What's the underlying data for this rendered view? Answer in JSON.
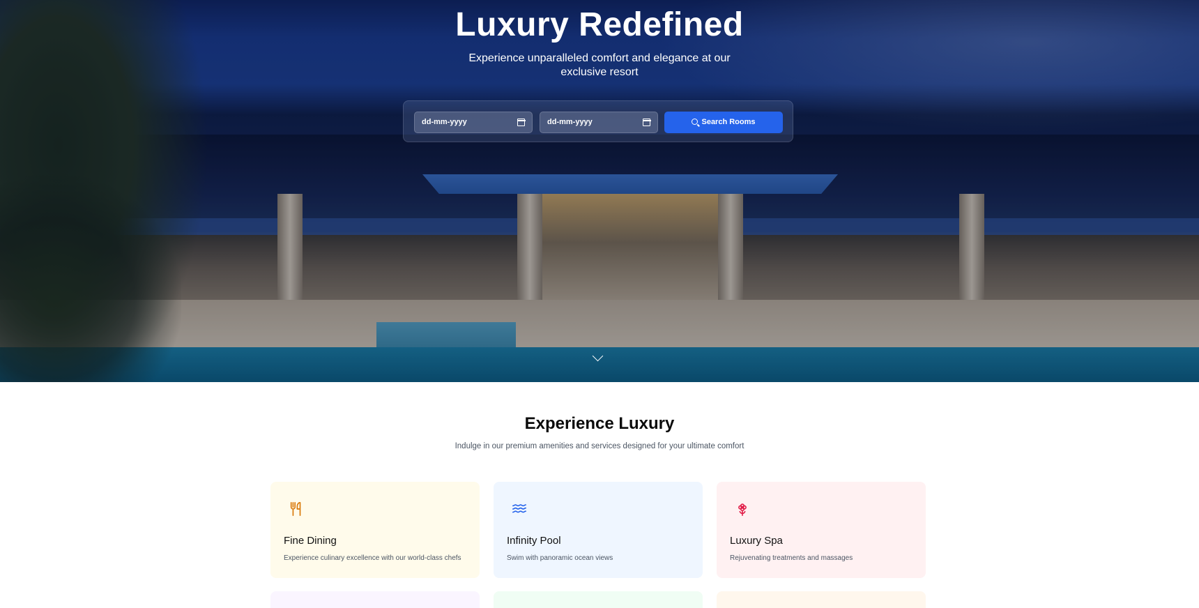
{
  "hero": {
    "title": "Luxury Redefined",
    "subtitle": "Experience unparalleled comfort and elegance at our exclusive resort",
    "check_in_placeholder": "dd-mm-yyyy",
    "check_out_placeholder": "dd-mm-yyyy",
    "search_label": "Search Rooms"
  },
  "amenities": {
    "title": "Experience Luxury",
    "subtitle": "Indulge in our premium amenities and services designed for your ultimate comfort",
    "cards": [
      {
        "title": "Fine Dining",
        "description": "Experience culinary excellence with our world-class chefs",
        "icon": "utensils-icon",
        "accent": "#d97706",
        "bg": "#fffbeb"
      },
      {
        "title": "Infinity Pool",
        "description": "Swim with panoramic ocean views",
        "icon": "waves-icon",
        "accent": "#2563eb",
        "bg": "#eff6ff"
      },
      {
        "title": "Luxury Spa",
        "description": "Rejuvenating treatments and massages",
        "icon": "flower-icon",
        "accent": "#e11d48",
        "bg": "#fff1f2"
      }
    ]
  },
  "colors": {
    "primary": "#2563eb",
    "hero_overlay": "#0a1a4a"
  }
}
